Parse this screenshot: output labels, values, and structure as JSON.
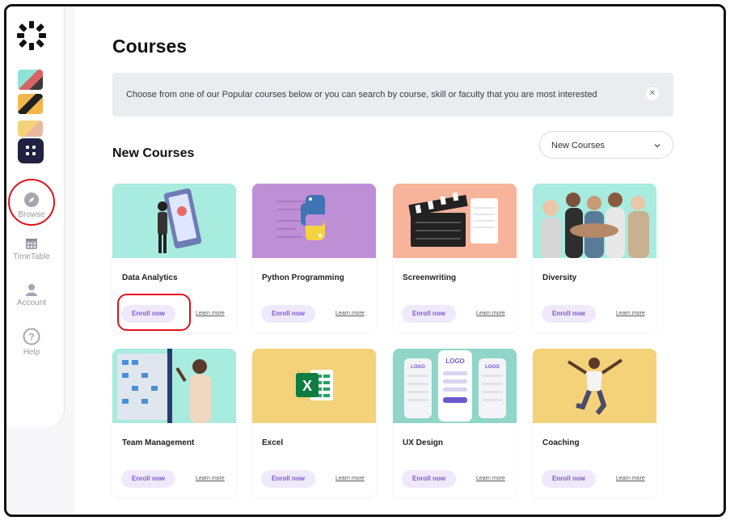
{
  "sidebar": {
    "nav": [
      {
        "label": "Browse",
        "icon": "compass-icon"
      },
      {
        "label": "TimeTable",
        "icon": "calendar-icon"
      },
      {
        "label": "Account",
        "icon": "person-icon"
      },
      {
        "label": "Help",
        "icon": "question-icon"
      }
    ]
  },
  "main": {
    "title": "Courses",
    "banner": "Choose from one of our Popular courses below or you can search by course, skill or faculty that you are most interested",
    "section_title": "New Courses",
    "filter": {
      "selected": "New Courses"
    },
    "enroll_label": "Enroll now",
    "learn_label": "Learn more",
    "courses": [
      {
        "title": "Data Analytics",
        "bg": "#a8ebdf"
      },
      {
        "title": "Python Programming",
        "bg": "#bf8fd6"
      },
      {
        "title": "Screenwriting",
        "bg": "#f7b49a"
      },
      {
        "title": "Diversity",
        "bg": "#a8ebdf"
      },
      {
        "title": "Team Management",
        "bg": "#a8ebdf"
      },
      {
        "title": "Excel",
        "bg": "#f3d27a"
      },
      {
        "title": "UX Design",
        "bg": "#8fd6c8"
      },
      {
        "title": "Coaching",
        "bg": "#f3d27a"
      }
    ]
  },
  "colors": {
    "accent": "#7a5bd0",
    "highlight": "#e0101a",
    "nav_dark": "#1f2240"
  }
}
